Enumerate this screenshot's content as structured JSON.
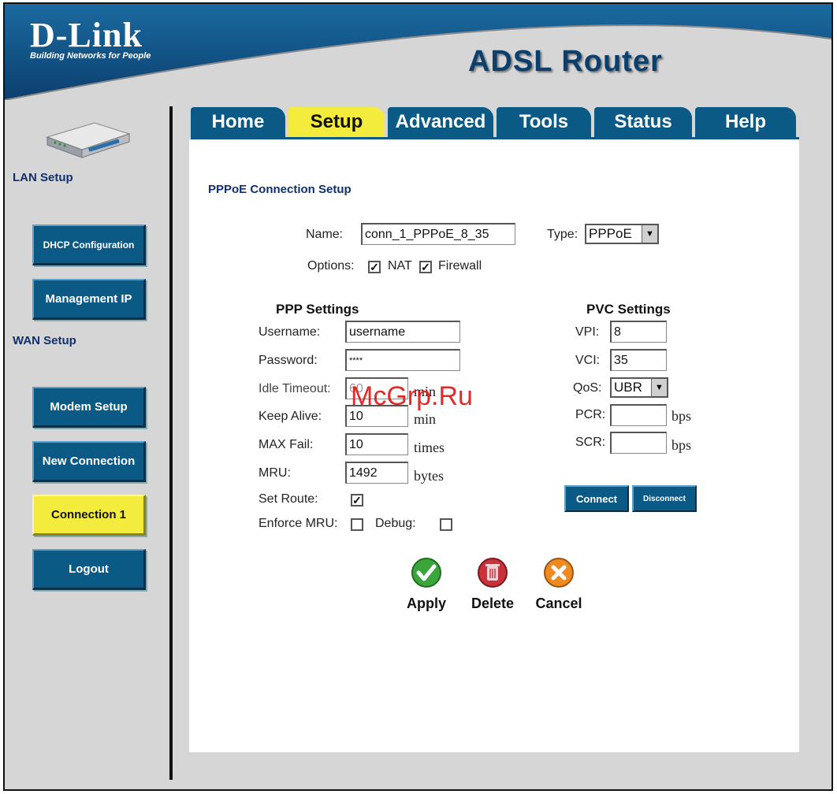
{
  "brand": {
    "name": "D-Link",
    "tagline": "Building Networks for People",
    "product": "ADSL Router"
  },
  "tabs": [
    {
      "label": "Home",
      "active": false
    },
    {
      "label": "Setup",
      "active": true
    },
    {
      "label": "Advanced",
      "active": false
    },
    {
      "label": "Tools",
      "active": false
    },
    {
      "label": "Status",
      "active": false
    },
    {
      "label": "Help",
      "active": false
    }
  ],
  "sidebar": {
    "lan_label": "LAN Setup",
    "wan_label": "WAN Setup",
    "items": [
      {
        "label": "DHCP Configuration",
        "active": false
      },
      {
        "label": "Management IP",
        "active": false
      },
      {
        "label": "Modem Setup",
        "active": false
      },
      {
        "label": "New Connection",
        "active": false
      },
      {
        "label": "Connection 1",
        "active": true
      },
      {
        "label": "Logout",
        "active": false
      }
    ]
  },
  "page": {
    "title": "PPPoE Connection Setup",
    "name_label": "Name:",
    "name_value": "conn_1_PPPoE_8_35",
    "type_label": "Type:",
    "type_value": "PPPoE",
    "options_label": "Options:",
    "nat_label": "NAT",
    "nat_checked": true,
    "firewall_label": "Firewall",
    "firewall_checked": true
  },
  "ppp": {
    "heading": "PPP Settings",
    "username_label": "Username:",
    "username_value": "username",
    "password_label": "Password:",
    "password_value": "****",
    "idle_label": "Idle Timeout:",
    "idle_value": "60",
    "idle_unit": "min",
    "keepalive_label": "Keep Alive:",
    "keepalive_value": "10",
    "keepalive_unit": "min",
    "maxfail_label": "MAX Fail:",
    "maxfail_value": "10",
    "maxfail_unit": "times",
    "mru_label": "MRU:",
    "mru_value": "1492",
    "mru_unit": "bytes",
    "setroute_label": "Set Route:",
    "setroute_checked": true,
    "enforce_label": "Enforce MRU:",
    "enforce_checked": false,
    "debug_label": "Debug:",
    "debug_checked": false
  },
  "pvc": {
    "heading": "PVC Settings",
    "vpi_label": "VPI:",
    "vpi_value": "8",
    "vci_label": "VCI:",
    "vci_value": "35",
    "qos_label": "QoS:",
    "qos_value": "UBR",
    "pcr_label": "PCR:",
    "pcr_value": "",
    "pcr_unit": "bps",
    "scr_label": "SCR:",
    "scr_value": "",
    "scr_unit": "bps",
    "connect_label": "Connect",
    "disconnect_label": "Disconnect"
  },
  "actions": {
    "apply_label": "Apply",
    "delete_label": "Delete",
    "cancel_label": "Cancel"
  },
  "watermark": "McGrp.Ru",
  "colors": {
    "brand_blue": "#0b5a86",
    "active_yellow": "#f4ec3c",
    "header_band": "#0b4f7e"
  }
}
